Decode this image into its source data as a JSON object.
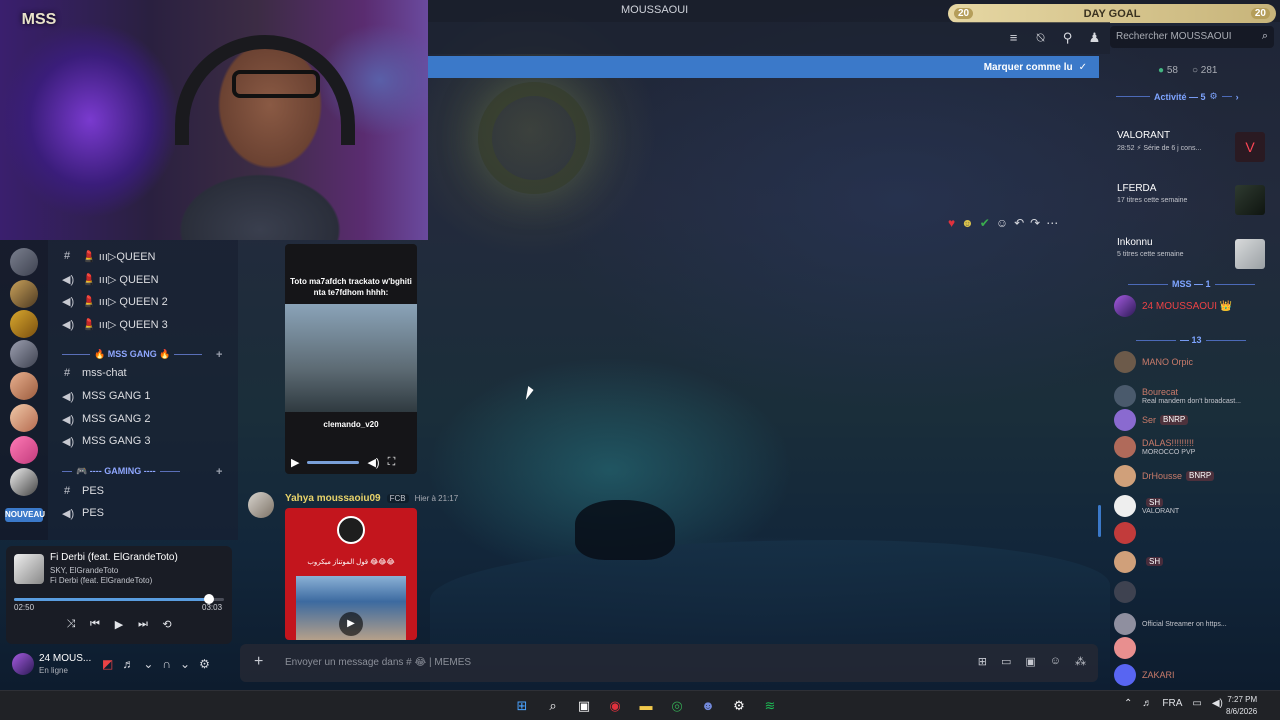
{
  "window": {
    "title": "MOUSSAOUI",
    "day_goal": {
      "label": "DAY GOAL",
      "current": "20",
      "target": "20"
    }
  },
  "header": {
    "search_placeholder": "Rechercher MOUSSAOUI",
    "mark_read_label": "Marquer comme lu"
  },
  "sidebar": {
    "new_badge": "NOUVEAU",
    "channels": [
      {
        "type": "text",
        "label": "💄 ııı▷QUEEN"
      },
      {
        "type": "voice",
        "label": "💄 ııı▷ QUEEN"
      },
      {
        "type": "voice",
        "label": "💄 ııı▷ QUEEN 2"
      },
      {
        "type": "voice",
        "label": "💄 ııı▷ QUEEN 3"
      }
    ],
    "category_mss": "🔥 MSS GANG 🔥",
    "mss_channels": [
      {
        "type": "text",
        "label": "mss-chat"
      },
      {
        "type": "voice",
        "label": "MSS GANG 1"
      },
      {
        "type": "voice",
        "label": "MSS GANG 2"
      },
      {
        "type": "voice",
        "label": "MSS GANG 3"
      }
    ],
    "category_gaming": "🎮 ---- GAMING ----",
    "gaming_channels": [
      {
        "type": "text",
        "label": "PES"
      },
      {
        "type": "voice",
        "label": "PES"
      }
    ]
  },
  "player": {
    "title": "Fi Derbi (feat. ElGrandeToto)",
    "artists": "SKY, ElGrandeToto",
    "album": "Fi Derbi (feat. ElGrandeToto)",
    "elapsed": "02:50",
    "duration": "03:03",
    "progress_fraction": 0.93
  },
  "user": {
    "name": "24 MOUS...",
    "status": "En ligne"
  },
  "messages": {
    "video_caption": "Toto ma7afdch trackato w'bghiti nta te7fdhom hhhh:",
    "video_watermark": "clemando_v20",
    "author": "Yahya moussaoiu09",
    "author_tag": "FCB",
    "timestamp": "Hier à 21:17",
    "image_text": "قول الموتناز ميكروب 😂😂😂"
  },
  "composer": {
    "placeholder": "Envoyer un message dans # 😂 | MEMES"
  },
  "members_panel": {
    "online_count": "58",
    "total_count": "281",
    "activity_title": "Activité — 5",
    "activities": [
      {
        "name": "VALORANT",
        "detail": "28:52 ⚡ Série de 6 j cons..."
      },
      {
        "name": "LFERDA",
        "detail": "17 titres cette semaine"
      },
      {
        "name": "Inkonnu",
        "detail": "5 titres cette semaine"
      }
    ],
    "group_mss": "MSS — 1",
    "mss_member": "24 MOUSSAOUI 👑",
    "group_other": "— 13",
    "members": [
      {
        "name": "MANO Orpic",
        "detail": "",
        "badge": ""
      },
      {
        "name": "Bourecat",
        "detail": "Real mandem don't broadcast...",
        "badge": ""
      },
      {
        "name": "Ser",
        "detail": "",
        "badge": "BNRP"
      },
      {
        "name": "DALAS!!!!!!!!!",
        "detail": "MOROCCO PVP",
        "badge": ""
      },
      {
        "name": "DrHousse",
        "detail": "",
        "badge": "BNRP"
      },
      {
        "name": "",
        "detail": "VALORANT",
        "badge": "SH"
      },
      {
        "name": "",
        "detail": "",
        "badge": ""
      },
      {
        "name": "",
        "detail": "",
        "badge": "SH"
      },
      {
        "name": "",
        "detail": "",
        "badge": ""
      },
      {
        "name": "",
        "detail": "Official Streamer on https...",
        "badge": ""
      },
      {
        "name": "",
        "detail": "",
        "badge": ""
      },
      {
        "name": "ZAKARI",
        "detail": "",
        "badge": ""
      }
    ]
  },
  "taskbar": {
    "language": "FRA",
    "time": "7:27 PM",
    "date": "8/6/2026"
  },
  "colors": {
    "accent": "#3b79c9",
    "danger": "#ed4245",
    "online": "#43b581",
    "goal": "#e6d7a3"
  }
}
